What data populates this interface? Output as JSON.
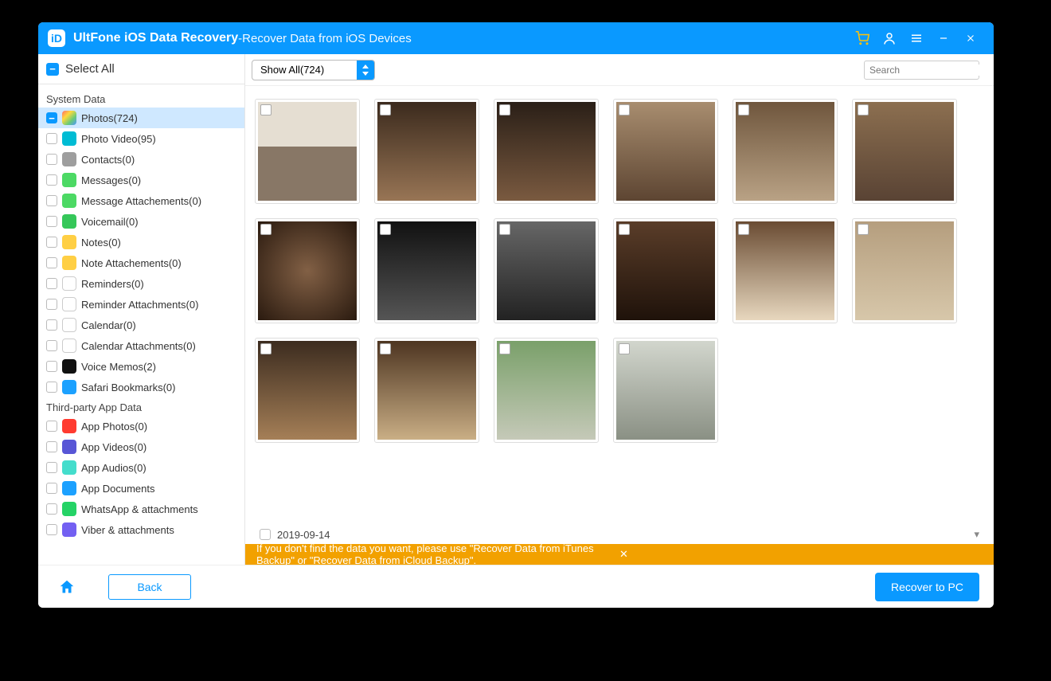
{
  "titlebar": {
    "app_name": "UltFone iOS Data Recovery",
    "separator": "  -  ",
    "subtitle": "Recover Data from iOS Devices"
  },
  "sidebar": {
    "select_all_label": "Select All",
    "sections": [
      {
        "header": "System Data",
        "items": [
          {
            "label": "Photos(724)",
            "icon_bg": "linear-gradient(135deg,#ff6b6b,#ffd93d,#6bcb77,#4d96ff)",
            "selected": true,
            "checked_minus": true
          },
          {
            "label": "Photo Video(95)",
            "icon_bg": "#00bcd4"
          },
          {
            "label": "Contacts(0)",
            "icon_bg": "#9e9e9e"
          },
          {
            "label": "Messages(0)",
            "icon_bg": "#4cd964"
          },
          {
            "label": "Message Attachements(0)",
            "icon_bg": "#4cd964"
          },
          {
            "label": "Voicemail(0)",
            "icon_bg": "#35c759"
          },
          {
            "label": "Notes(0)",
            "icon_bg": "#ffcf44"
          },
          {
            "label": "Note Attachements(0)",
            "icon_bg": "#ffcf44"
          },
          {
            "label": "Reminders(0)",
            "icon_bg": "#ffffff"
          },
          {
            "label": "Reminder Attachments(0)",
            "icon_bg": "#ffffff"
          },
          {
            "label": "Calendar(0)",
            "icon_bg": "#ffffff"
          },
          {
            "label": "Calendar Attachments(0)",
            "icon_bg": "#ffffff"
          },
          {
            "label": "Voice Memos(2)",
            "icon_bg": "#111111"
          },
          {
            "label": "Safari Bookmarks(0)",
            "icon_bg": "#1ca1ff"
          }
        ]
      },
      {
        "header": "Third-party App Data",
        "items": [
          {
            "label": "App Photos(0)",
            "icon_bg": "#ff3b30"
          },
          {
            "label": "App Videos(0)",
            "icon_bg": "#5856d6"
          },
          {
            "label": "App Audios(0)",
            "icon_bg": "#44ddcc"
          },
          {
            "label": "App Documents",
            "icon_bg": "#1ca1ff"
          },
          {
            "label": "WhatsApp & attachments",
            "icon_bg": "#25d366"
          },
          {
            "label": "Viber & attachments",
            "icon_bg": "#7360f2"
          }
        ]
      }
    ]
  },
  "toolbar": {
    "filter_label": "Show All(724)",
    "search_placeholder": "Search"
  },
  "grid": {
    "thumbs": [
      {
        "cls": "t0"
      },
      {
        "cls": "t1"
      },
      {
        "cls": "t2"
      },
      {
        "cls": "t3"
      },
      {
        "cls": "t4"
      },
      {
        "cls": "t5"
      },
      {
        "cls": "t6"
      },
      {
        "cls": "t7"
      },
      {
        "cls": "t8"
      },
      {
        "cls": "t9"
      },
      {
        "cls": "t10"
      },
      {
        "cls": "t11"
      },
      {
        "cls": "t12"
      },
      {
        "cls": "t13"
      },
      {
        "cls": "t14"
      },
      {
        "cls": "t15"
      }
    ],
    "date_group": "2019-09-14"
  },
  "infobar": {
    "message": "If you don't find the data you want, please use \"Recover Data from iTunes Backup\" or \"Recover Data from iCloud Backup\"."
  },
  "footer": {
    "back_label": "Back",
    "recover_label": "Recover to PC"
  }
}
